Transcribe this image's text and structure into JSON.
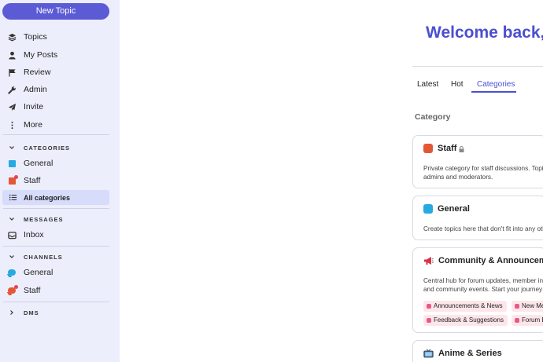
{
  "sidebar": {
    "new_topic": "New Topic",
    "nav": [
      {
        "label": "Topics",
        "icon": "layers-icon"
      },
      {
        "label": "My Posts",
        "icon": "user-icon"
      },
      {
        "label": "Review",
        "icon": "flag-icon"
      },
      {
        "label": "Admin",
        "icon": "wrench-icon"
      },
      {
        "label": "Invite",
        "icon": "paper-plane-icon"
      },
      {
        "label": "More",
        "icon": "more-vertical-icon"
      }
    ],
    "categories_header": "CATEGORIES",
    "categories": [
      {
        "label": "General",
        "color": "#25aae1"
      },
      {
        "label": "Staff",
        "color": "#e45735"
      },
      {
        "label": "All categories",
        "icon": "list-icon"
      }
    ],
    "messages_header": "MESSAGES",
    "messages": [
      {
        "label": "Inbox",
        "icon": "inbox-icon"
      }
    ],
    "channels_header": "CHANNELS",
    "channels": [
      {
        "label": "General",
        "color": "#25aae1"
      },
      {
        "label": "Staff",
        "color": "#e45735"
      }
    ],
    "dms_header": "DMS"
  },
  "main": {
    "welcome": "Welcome back,",
    "tabs": [
      {
        "label": "Latest"
      },
      {
        "label": "Hot"
      },
      {
        "label": "Categories",
        "active": true
      }
    ],
    "category_header": "Category",
    "cards": [
      {
        "title": "Staff",
        "color": "#e45735",
        "desc_line1": "Private category for staff discussions. Topic",
        "desc_line2": "admins and moderators."
      },
      {
        "title": "General",
        "color": "#25aae1",
        "desc_line1": "Create topics here that don't fit into any othe"
      },
      {
        "title": "Community & Announceme",
        "emoji": "megaphone-icon",
        "desc_line1": "Central hub for forum updates, member intr",
        "desc_line2": "and community events. Start your journey h",
        "tags": [
          "Announcements & News",
          "New Me",
          "Feedback & Suggestions",
          "Forum E"
        ]
      },
      {
        "title": "Anime & Series",
        "emoji": "tv-icon"
      }
    ]
  },
  "colors": {
    "accent": "#4b4fd0",
    "sidebar_bg": "#eceefc",
    "active_bg": "#d7dcfb"
  }
}
